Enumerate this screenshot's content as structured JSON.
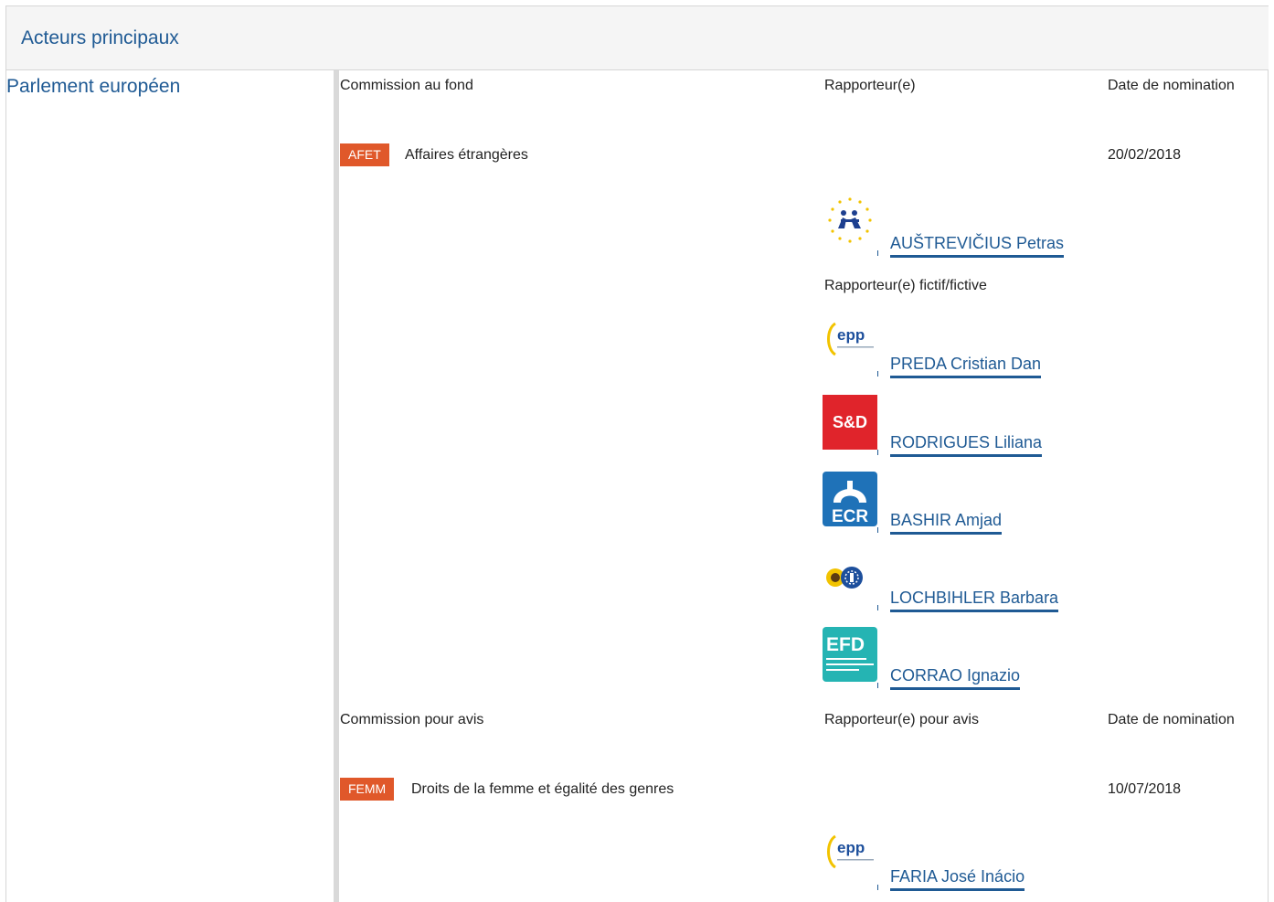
{
  "header": {
    "title": "Acteurs principaux"
  },
  "side": {
    "label": "Parlement européen"
  },
  "lead": {
    "col_committee": "Commission au fond",
    "col_rapporteur": "Rapporteur(e)",
    "col_date": "Date de nomination",
    "committee_code": "AFET",
    "committee_name": "Affaires étrangères",
    "date": "20/02/2018",
    "rapporteur": {
      "name": "AUŠTREVIČIUS Petras",
      "group_icon": "alde-logo-icon"
    },
    "shadow_label": "Rapporteur(e) fictif/fictive",
    "shadows": [
      {
        "name": "PREDA Cristian Dan",
        "group_icon": "epp-logo-icon"
      },
      {
        "name": "RODRIGUES Liliana",
        "group_icon": "sd-logo-icon",
        "logo_text": "S&D"
      },
      {
        "name": "BASHIR Amjad",
        "group_icon": "ecr-logo-icon",
        "logo_text": "ECR"
      },
      {
        "name": "LOCHBIHLER Barbara",
        "group_icon": "greens-efa-logo-icon"
      },
      {
        "name": "CORRAO Ignazio",
        "group_icon": "efdd-logo-icon",
        "logo_text": "EFD"
      }
    ]
  },
  "opinion": {
    "col_committee": "Commission pour avis",
    "col_rapporteur": "Rapporteur(e) pour avis",
    "col_date": "Date de nomination",
    "committee_code": "FEMM",
    "committee_name": "Droits de la femme et égalité des genres",
    "date": "10/07/2018",
    "rapporteur": {
      "name": "FARIA José Inácio",
      "group_icon": "epp-logo-icon"
    }
  },
  "colors": {
    "link": "#1f5a94",
    "badge": "#e0582a",
    "header_bg": "#f5f5f5",
    "divider": "#d9d9d9"
  }
}
